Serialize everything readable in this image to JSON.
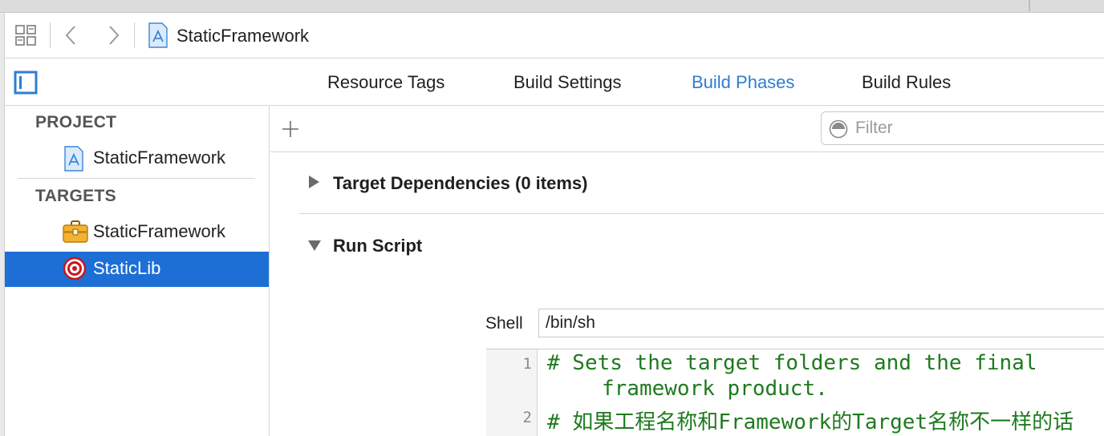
{
  "nav": {
    "breadcrumb_title": "StaticFramework"
  },
  "tabs": [
    {
      "label": "Resource Tags",
      "active": false
    },
    {
      "label": "Build Settings",
      "active": false
    },
    {
      "label": "Build Phases",
      "active": true
    },
    {
      "label": "Build Rules",
      "active": false
    }
  ],
  "sidebar": {
    "project_heading": "PROJECT",
    "project_item": {
      "label": "StaticFramework",
      "icon": "xcode-project-icon"
    },
    "targets_heading": "TARGETS",
    "targets": [
      {
        "label": "StaticFramework",
        "icon": "toolbox-icon",
        "selected": false
      },
      {
        "label": "StaticLib",
        "icon": "target-icon",
        "selected": true
      }
    ]
  },
  "main": {
    "filter_placeholder": "Filter",
    "phases": [
      {
        "label": "Target Dependencies (0 items)",
        "expanded": false
      },
      {
        "label": "Run Script",
        "expanded": true
      }
    ],
    "shell_label": "Shell",
    "shell_value": "/bin/sh",
    "script_lines": [
      {
        "number": "1",
        "text": "# Sets the target folders and the final",
        "continuation": "framework product."
      },
      {
        "number": "2",
        "text": "# 如果工程名称和Framework的Target名称不一样的话"
      }
    ]
  },
  "colors": {
    "accent": "#2f7dd1",
    "selection": "#1d6fd6",
    "comment_green": "#1e7a1e"
  }
}
